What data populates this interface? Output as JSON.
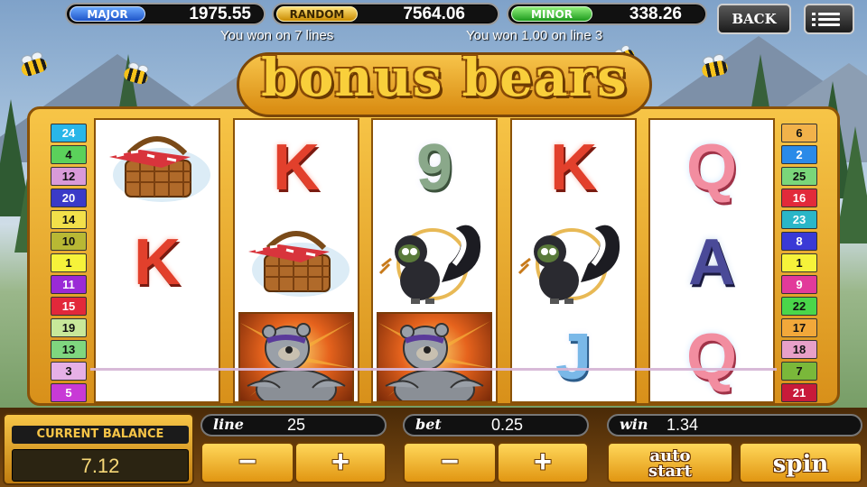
{
  "jackpots": [
    {
      "label": "MAJOR",
      "value": "1975.55",
      "style": "major"
    },
    {
      "label": "RANDOM",
      "value": "7564.06",
      "style": "random"
    },
    {
      "label": "MINOR",
      "value": "338.26",
      "style": "minor"
    }
  ],
  "top": {
    "back_label": "BACK",
    "menu_icon": "hamburger-menu-icon"
  },
  "messages": {
    "left": "You won on 7 lines",
    "right": "You won 1.00 on line 3"
  },
  "title": "bonus bears",
  "paylines_left": [
    "24",
    "4",
    "12",
    "20",
    "14",
    "10",
    "1",
    "11",
    "15",
    "19",
    "13",
    "3",
    "5"
  ],
  "paylines_right": [
    "6",
    "2",
    "25",
    "16",
    "23",
    "8",
    "1",
    "9",
    "22",
    "17",
    "18",
    "7",
    "21"
  ],
  "payline_colors": {
    "24": "#29b6e8",
    "4": "#5bd15b",
    "12": "#d99ad9",
    "20": "#3a3ac8",
    "14": "#f2e04a",
    "10": "#b8b834",
    "1": "#f6f23a",
    "11": "#9a2ad6",
    "15": "#e2283a",
    "19": "#c8e89a",
    "13": "#7fd67f",
    "3": "#e6b0e6",
    "5": "#c83ad6",
    "6": "#f2b24a",
    "2": "#2a8ae8",
    "25": "#7ad67a",
    "16": "#e22a3a",
    "23": "#2ab6c8",
    "8": "#3a3ad6",
    "9": "#e23a9a",
    "22": "#4ad64a",
    "17": "#f2a83a",
    "18": "#e8a0c8",
    "7": "#7ab83a",
    "21": "#c81a3a"
  },
  "reels": [
    [
      "picnic-basket",
      "K"
    ],
    [
      "K",
      "picnic-basket",
      "bear"
    ],
    [
      "9",
      "skunk",
      "bear"
    ],
    [
      "K",
      "skunk",
      "J"
    ],
    [
      "Q",
      "A",
      "Q"
    ]
  ],
  "controls": {
    "balance_label": "CURRENT BALANCE",
    "balance_value": "7.12",
    "line_label": "line",
    "line_value": "25",
    "bet_label": "bet",
    "bet_value": "0.25",
    "win_label": "win",
    "win_value": "1.34",
    "minus": "−",
    "plus": "+",
    "autostart_line1": "auto",
    "autostart_line2": "start",
    "spin_label": "spin"
  }
}
